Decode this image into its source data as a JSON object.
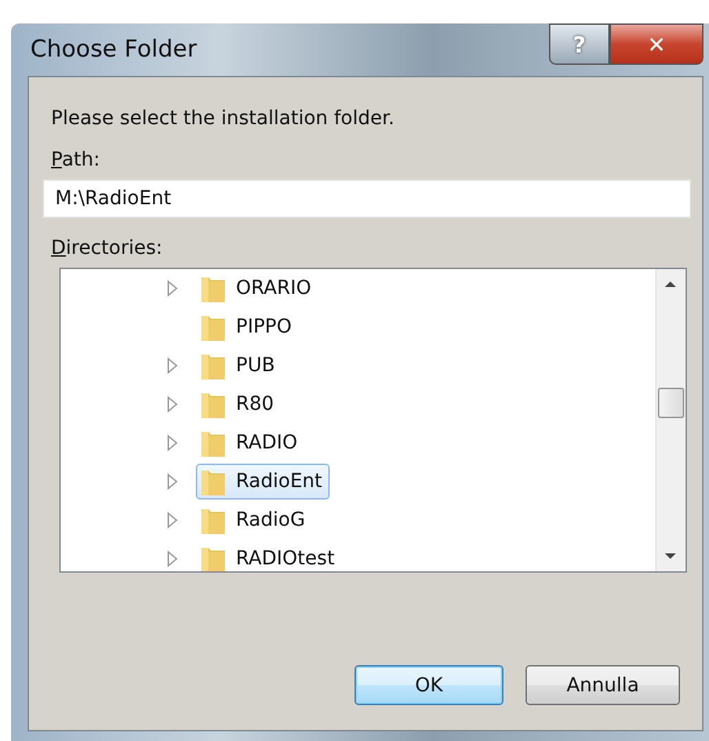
{
  "window": {
    "title": "Choose Folder",
    "help_glyph": "?",
    "close_glyph": "✕"
  },
  "prompt": "Please select the installation folder.",
  "path": {
    "label": "Path:",
    "value": "M:\\RadioEnt"
  },
  "directories": {
    "label": "Directories:",
    "items": [
      {
        "name": "ORARIO",
        "has_children": true,
        "selected": false
      },
      {
        "name": "PIPPO",
        "has_children": false,
        "selected": false
      },
      {
        "name": "PUB",
        "has_children": true,
        "selected": false
      },
      {
        "name": "R80",
        "has_children": true,
        "selected": false
      },
      {
        "name": "RADIO",
        "has_children": true,
        "selected": false
      },
      {
        "name": "RadioEnt",
        "has_children": true,
        "selected": true
      },
      {
        "name": "RadioG",
        "has_children": true,
        "selected": false
      },
      {
        "name": "RADIOtest",
        "has_children": true,
        "selected": false
      }
    ]
  },
  "buttons": [
    {
      "label": "OK",
      "default": true
    },
    {
      "label": "Annulla",
      "default": false
    }
  ]
}
